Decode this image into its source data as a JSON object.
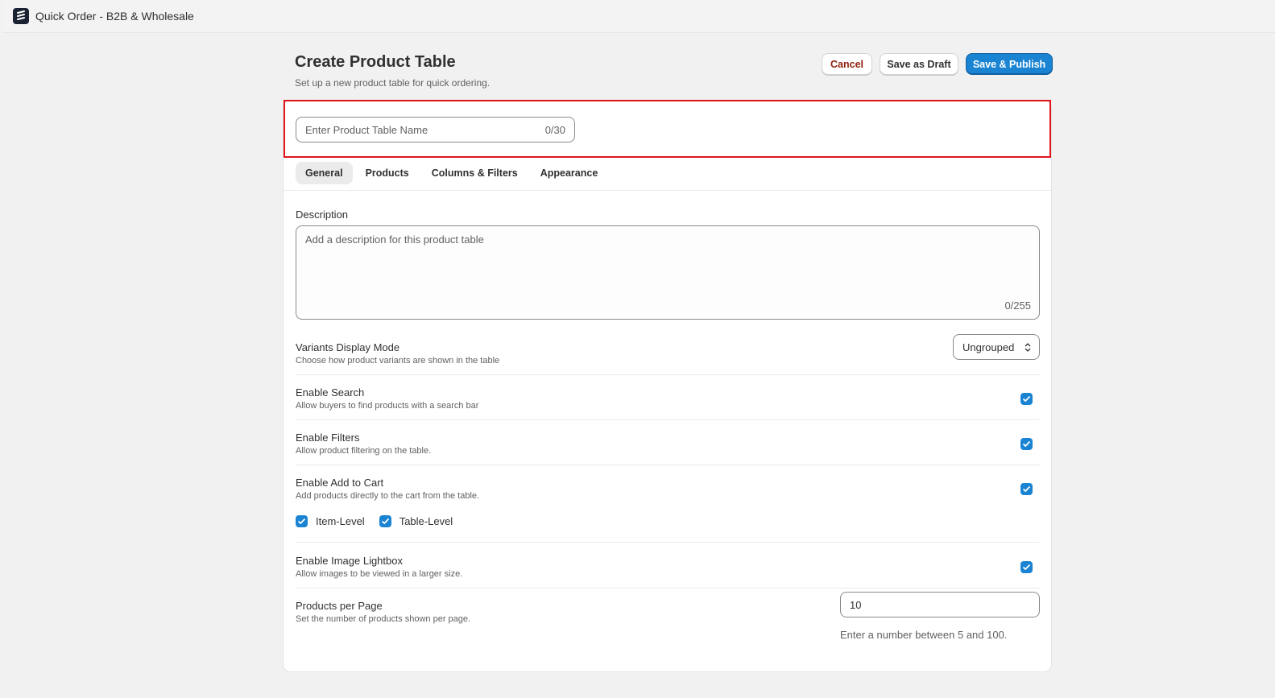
{
  "app": {
    "title": "Quick Order - B2B & Wholesale",
    "logo_icon": "app-logo-icon"
  },
  "header": {
    "title": "Create Product Table",
    "subtitle": "Set up a new product table for quick ordering.",
    "cancel_label": "Cancel",
    "draft_label": "Save as Draft",
    "publish_label": "Save & Publish"
  },
  "name_field": {
    "placeholder": "Enter Product Table Name",
    "count": "0/30"
  },
  "tabs": [
    {
      "label": "General",
      "active": true
    },
    {
      "label": "Products",
      "active": false
    },
    {
      "label": "Columns & Filters",
      "active": false
    },
    {
      "label": "Appearance",
      "active": false
    }
  ],
  "description": {
    "label": "Description",
    "placeholder": "Add a description for this product table",
    "count": "0/255"
  },
  "settings": {
    "variants": {
      "title": "Variants Display Mode",
      "desc": "Choose how product variants are shown in the table",
      "value": "Ungrouped"
    },
    "search": {
      "title": "Enable Search",
      "desc": "Allow buyers to find products with a search bar",
      "checked": true
    },
    "filters": {
      "title": "Enable Filters",
      "desc": "Allow product filtering on the table.",
      "checked": true
    },
    "cart": {
      "title": "Enable Add to Cart",
      "desc": "Add products directly to the cart from the table.",
      "checked": true,
      "item_level": "Item-Level",
      "table_level": "Table-Level"
    },
    "lightbox": {
      "title": "Enable Image Lightbox",
      "desc": "Allow images to be viewed in a larger size.",
      "checked": true
    },
    "per_page": {
      "title": "Products per Page",
      "desc": "Set the number of products shown per page.",
      "value": "10",
      "help": "Enter a number between 5 and 100."
    }
  },
  "colors": {
    "accent": "#1a84d3",
    "danger_text": "#8e1f0b",
    "highlight": "#e0131b"
  }
}
